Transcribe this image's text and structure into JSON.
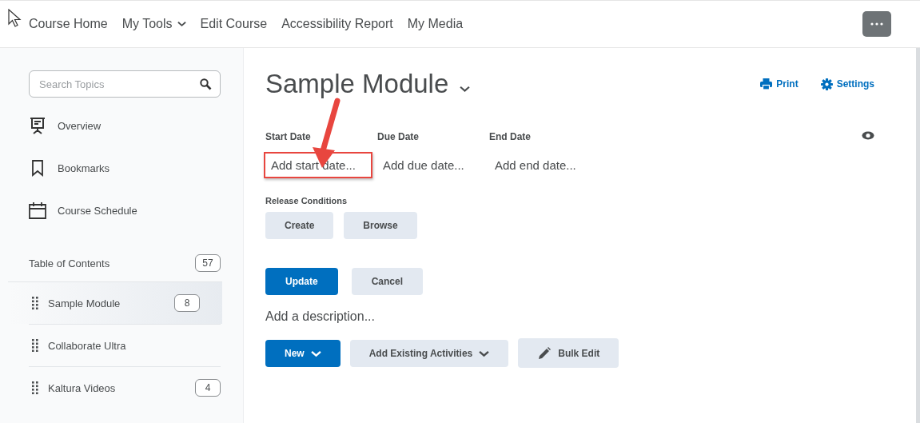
{
  "nav": {
    "items": [
      {
        "label": "Course Home",
        "dropdown": false
      },
      {
        "label": "My Tools",
        "dropdown": true
      },
      {
        "label": "Edit Course",
        "dropdown": false
      },
      {
        "label": "Accessibility Report",
        "dropdown": false
      },
      {
        "label": "My Media",
        "dropdown": false
      }
    ]
  },
  "sidebar": {
    "search": {
      "placeholder": "Search Topics"
    },
    "links": [
      {
        "kind": "overview",
        "label": "Overview"
      },
      {
        "kind": "bookmarks",
        "label": "Bookmarks"
      },
      {
        "kind": "schedule",
        "label": "Course Schedule"
      }
    ],
    "toc": {
      "label": "Table of Contents",
      "count": "57"
    },
    "modules": [
      {
        "label": "Sample Module",
        "count": "8",
        "selected": true
      },
      {
        "label": "Collaborate Ultra",
        "selected": false
      },
      {
        "label": "Kaltura Videos",
        "count": "4",
        "selected": false
      }
    ]
  },
  "main": {
    "title": "Sample Module",
    "actions": [
      {
        "kind": "print",
        "label": "Print"
      },
      {
        "kind": "settings",
        "label": "Settings"
      }
    ],
    "dates": [
      {
        "label": "Start Date",
        "placeholder": "Add start date...",
        "highlighted": true
      },
      {
        "label": "Due Date",
        "placeholder": "Add due date...",
        "highlighted": false
      },
      {
        "label": "End Date",
        "placeholder": "Add end date...",
        "highlighted": false
      }
    ],
    "release_conditions": {
      "label": "Release Conditions",
      "buttons": [
        "Create",
        "Browse"
      ]
    },
    "form_buttons": [
      {
        "label": "Update",
        "primary": true
      },
      {
        "label": "Cancel",
        "primary": false
      }
    ],
    "description": {
      "placeholder": "Add a description..."
    },
    "toolbar": [
      {
        "kind": "new",
        "label": "New",
        "primary": true
      },
      {
        "kind": "existing",
        "label": "Add Existing Activities",
        "primary": false
      },
      {
        "kind": "bulk",
        "label": "Bulk Edit",
        "primary": false
      }
    ]
  }
}
